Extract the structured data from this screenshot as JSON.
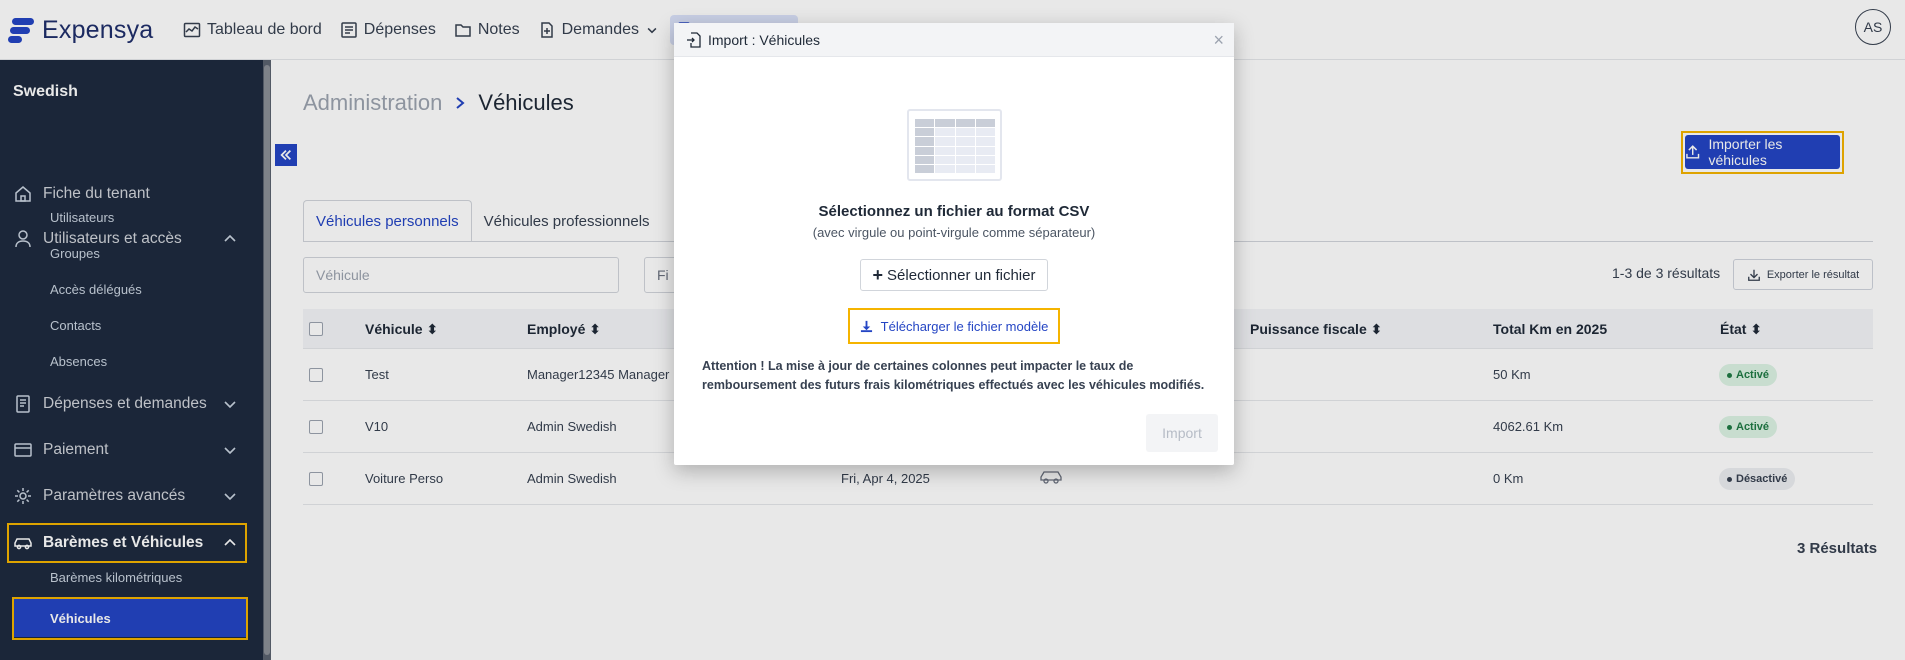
{
  "app": {
    "name": "Expensya",
    "avatar_initials": "AS",
    "accent_color": "#2445c4",
    "highlight_color": "#f5b400"
  },
  "topnav": {
    "items": [
      {
        "label": "Tableau de bord",
        "icon": "dashboard-icon"
      },
      {
        "label": "Dépenses",
        "icon": "receipt-icon"
      },
      {
        "label": "Notes",
        "icon": "folder-icon"
      },
      {
        "label": "Demandes",
        "icon": "request-icon"
      }
    ]
  },
  "sidebar": {
    "tenant": "Swedish",
    "items": [
      {
        "label": "Fiche du tenant",
        "icon": "home-icon"
      },
      {
        "label": "Utilisateurs et accès",
        "icon": "user-icon",
        "expanded": true
      },
      {
        "label": "Dépenses et demandes",
        "icon": "document-icon",
        "expanded": false
      },
      {
        "label": "Paiement",
        "icon": "card-icon",
        "expanded": false
      },
      {
        "label": "Paramètres avancés",
        "icon": "gear-icon",
        "expanded": false
      },
      {
        "label": "Barèmes et Véhicules",
        "icon": "car-icon",
        "expanded": true
      }
    ],
    "users_sub": [
      "Utilisateurs",
      "Groupes",
      "Accès délégués",
      "Contacts",
      "Absences"
    ],
    "vehicles_sub": [
      "Barèmes kilométriques",
      "Véhicules"
    ]
  },
  "main": {
    "breadcrumb_parent": "Administration",
    "breadcrumb_current": "Véhicules",
    "import_button": "Importer les véhicules",
    "tabs": [
      "Véhicules personnels",
      "Véhicules professionnels"
    ],
    "search_placeholder": "Véhicule",
    "filter_label": "Fi",
    "results_text": "1-3 de 3 résultats",
    "export_button": "Exporter le résultat",
    "columns": [
      "Véhicule",
      "Employé",
      "Puissance fiscale",
      "Total Km en 2025",
      "État"
    ],
    "rows": [
      {
        "vehicle": "Test",
        "employee": "Manager12345 Manager",
        "date": "",
        "km": "50 Km",
        "state": "Activé",
        "active": true
      },
      {
        "vehicle": "V10",
        "employee": "Admin Swedish",
        "date": "",
        "km": "4062.61 Km",
        "state": "Activé",
        "active": true
      },
      {
        "vehicle": "Voiture Perso",
        "employee": "Admin Swedish",
        "date": "Fri, Apr 4, 2025",
        "km": "0 Km",
        "state": "Désactivé",
        "active": false
      }
    ],
    "total_results": "3 Résultats"
  },
  "modal": {
    "title": "Import : Véhicules",
    "heading": "Sélectionnez un fichier au format CSV",
    "subheading": "(avec virgule ou point-virgule comme séparateur)",
    "select_button": "Sélectionner un fichier",
    "download_link": "Télécharger le fichier modèle",
    "warning": "Attention ! La mise à jour de certaines colonnes peut impacter le taux de remboursement des futurs frais kilométriques effectués avec les véhicules modifiés.",
    "import_button": "Import",
    "close": "×"
  }
}
